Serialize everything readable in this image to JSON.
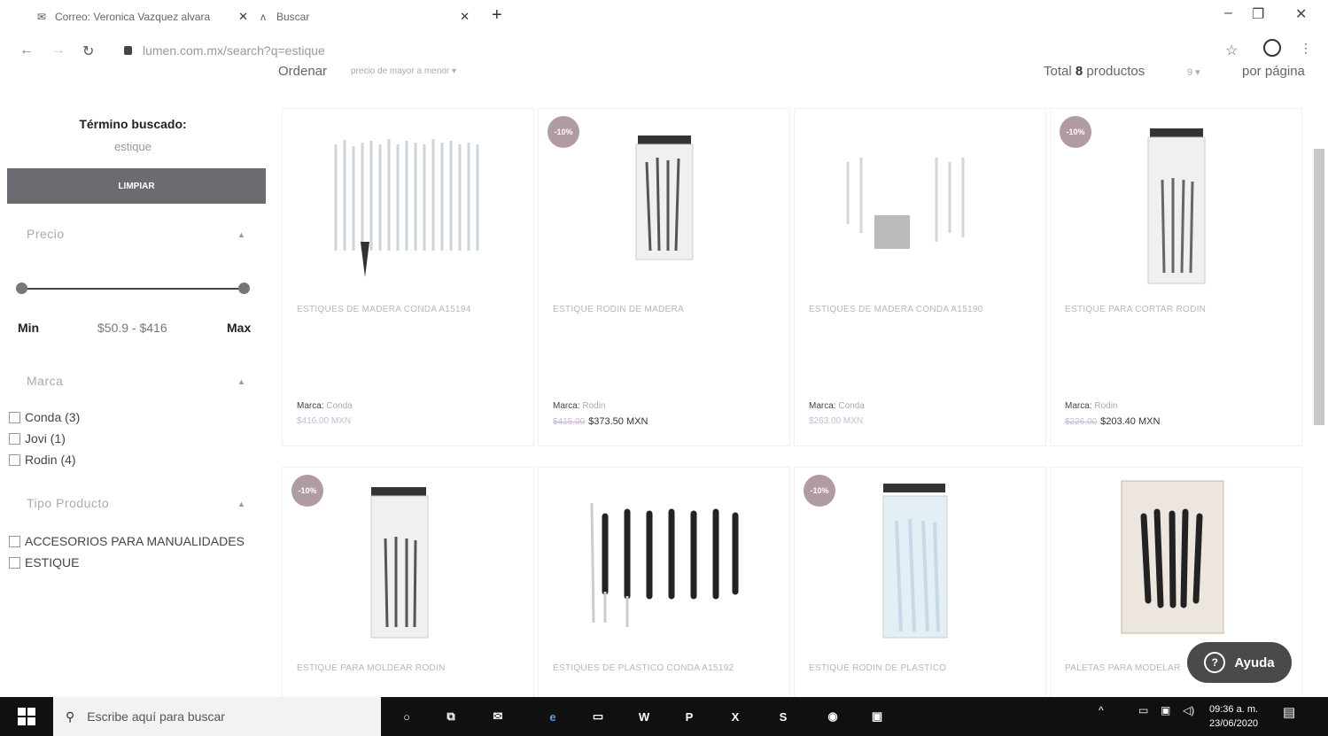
{
  "browser": {
    "tabs": [
      {
        "label": "Correo: Veronica Vazquez alvara",
        "icon": "mail-icon"
      },
      {
        "label": "Buscar",
        "icon": "site-icon"
      }
    ],
    "url": "lumen.com.mx/search?q=estique"
  },
  "toolbar": {
    "sort_label": "Ordenar",
    "sort_value": "precio de mayor a menor",
    "total_prefix": "Total",
    "total_count": "8",
    "total_suffix": "productos",
    "per_page_value": "9",
    "per_page_label": "por página"
  },
  "sidebar": {
    "term_heading": "Término buscado:",
    "term_value": "estique",
    "clear_label": "LIMPIAR",
    "price": {
      "heading": "Precio",
      "min_label": "Min",
      "max_label": "Max",
      "range": "$50.9 - $416"
    },
    "brand": {
      "heading": "Marca",
      "options": [
        "Conda (3)",
        "Jovi (1)",
        "Rodin (4)"
      ]
    },
    "type": {
      "heading": "Tipo Producto",
      "options": [
        "ACCESORIOS PARA MANUALIDADES",
        "ESTIQUE"
      ]
    }
  },
  "products": [
    {
      "name": "ESTIQUES DE MADERA CONDA A15194",
      "brand_label": "Marca:",
      "brand": "Conda",
      "old_price": "$416.00 MXN",
      "price": "",
      "badge": ""
    },
    {
      "name": "ESTIQUE RODIN DE MADERA",
      "brand_label": "Marca:",
      "brand": "Rodin",
      "old_price": "$415.00",
      "price": "$373.50 MXN",
      "badge": "-10%"
    },
    {
      "name": "ESTIQUES DE MADERA CONDA A15190",
      "brand_label": "Marca:",
      "brand": "Conda",
      "old_price": "$263.00 MXN",
      "price": "",
      "badge": ""
    },
    {
      "name": "ESTIQUE PARA CORTAR RODIN",
      "brand_label": "Marca:",
      "brand": "Rodin",
      "old_price": "$226.00",
      "price": "$203.40 MXN",
      "badge": "-10%"
    },
    {
      "name": "ESTIQUE PARA MOLDEAR RODIN",
      "badge": "-10%"
    },
    {
      "name": "ESTIQUES DE PLASTICO CONDA A15192",
      "badge": ""
    },
    {
      "name": "ESTIQUE RODIN DE PLASTICO",
      "badge": "-10%"
    },
    {
      "name": "PALETAS PARA MODELAR",
      "badge": ""
    }
  ],
  "help_label": "Ayuda",
  "taskbar": {
    "search_placeholder": "Escribe aquí para buscar",
    "time": "09:36 a. m.",
    "date": "23/06/2020"
  }
}
